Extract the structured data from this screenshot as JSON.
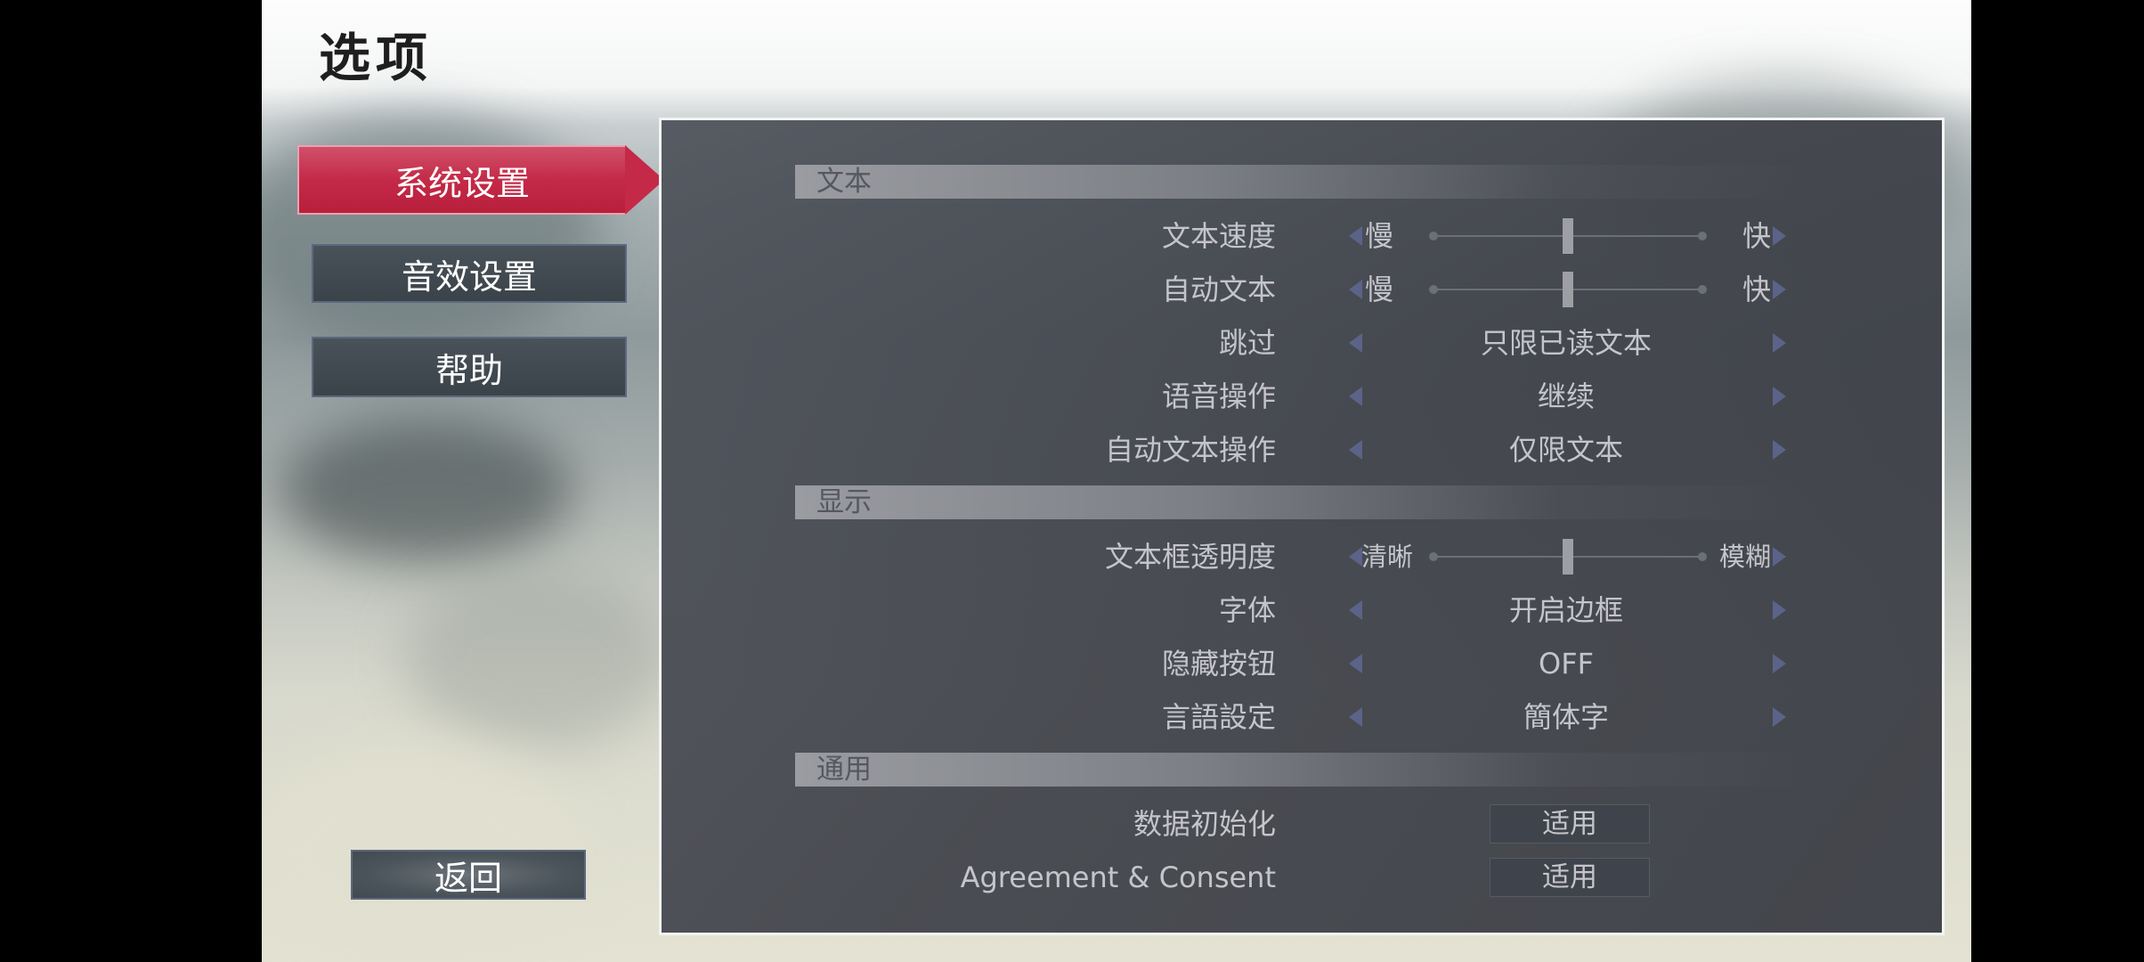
{
  "screen": {
    "title": "选项"
  },
  "menu": {
    "items": [
      {
        "label": "系统设置",
        "selected": true
      },
      {
        "label": "音效设置",
        "selected": false
      },
      {
        "label": "帮助",
        "selected": false
      }
    ],
    "back_label": "返回"
  },
  "sections": {
    "text": "文本",
    "display": "显示",
    "general": "通用"
  },
  "settings": {
    "text_speed": {
      "label": "文本速度",
      "min_label": "慢",
      "max_label": "快",
      "level": 0.5
    },
    "auto_text": {
      "label": "自动文本",
      "min_label": "慢",
      "max_label": "快",
      "level": 0.5
    },
    "skip": {
      "label": "跳过",
      "value": "只限已读文本"
    },
    "voice_action": {
      "label": "语音操作",
      "value": "继续"
    },
    "auto_text_action": {
      "label": "自动文本操作",
      "value": "仅限文本"
    },
    "textbox_opacity": {
      "label": "文本框透明度",
      "min_label": "清晰",
      "max_label": "模糊",
      "level": 0.5
    },
    "font": {
      "label": "字体",
      "value": "开启边框"
    },
    "hide_buttons": {
      "label": "隐藏按钮",
      "value": "OFF"
    },
    "language": {
      "label": "言語設定",
      "value": "簡体字"
    },
    "data_init": {
      "label": "数据初始化",
      "button_label": "适用"
    },
    "agreement": {
      "label": "Agreement & Consent",
      "button_label": "适用"
    }
  },
  "colors": {
    "accent": "#c42a47",
    "panel": "#4a4e56",
    "arrow": "#5b6389",
    "text": "#c4c5ca"
  },
  "icons": {
    "left_arrow": "triangle-left-icon",
    "right_arrow": "triangle-right-icon"
  }
}
